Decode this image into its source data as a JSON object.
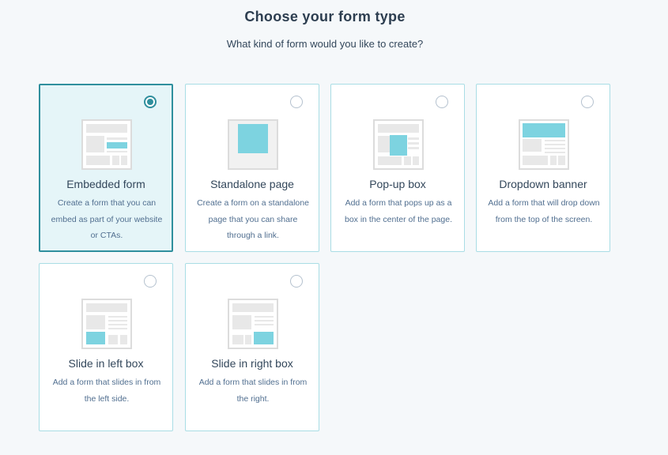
{
  "header": {
    "title": "Choose your form type",
    "subtitle": "What kind of form would you like to create?"
  },
  "colors": {
    "accent": "#2f8f9d",
    "selected_bg": "#e5f5f8",
    "card_border": "#a9dde5",
    "illus_highlight": "#7dd3e0",
    "illus_gray": "#eaeaea"
  },
  "form_types": [
    {
      "title": "Embedded form",
      "description": "Create a form that you can embed as part of your website or CTAs.",
      "selected": true
    },
    {
      "title": "Standalone page",
      "description": "Create a form on a standalone page that you can share through a link.",
      "selected": false
    },
    {
      "title": "Pop-up box",
      "description": "Add a form that pops up as a box in the center of the page.",
      "selected": false
    },
    {
      "title": "Dropdown banner",
      "description": "Add a form that will drop down from the top of the screen.",
      "selected": false
    },
    {
      "title": "Slide in left box",
      "description": "Add a form that slides in from the left side.",
      "selected": false
    },
    {
      "title": "Slide in right box",
      "description": "Add a form that slides in from the right.",
      "selected": false
    }
  ]
}
